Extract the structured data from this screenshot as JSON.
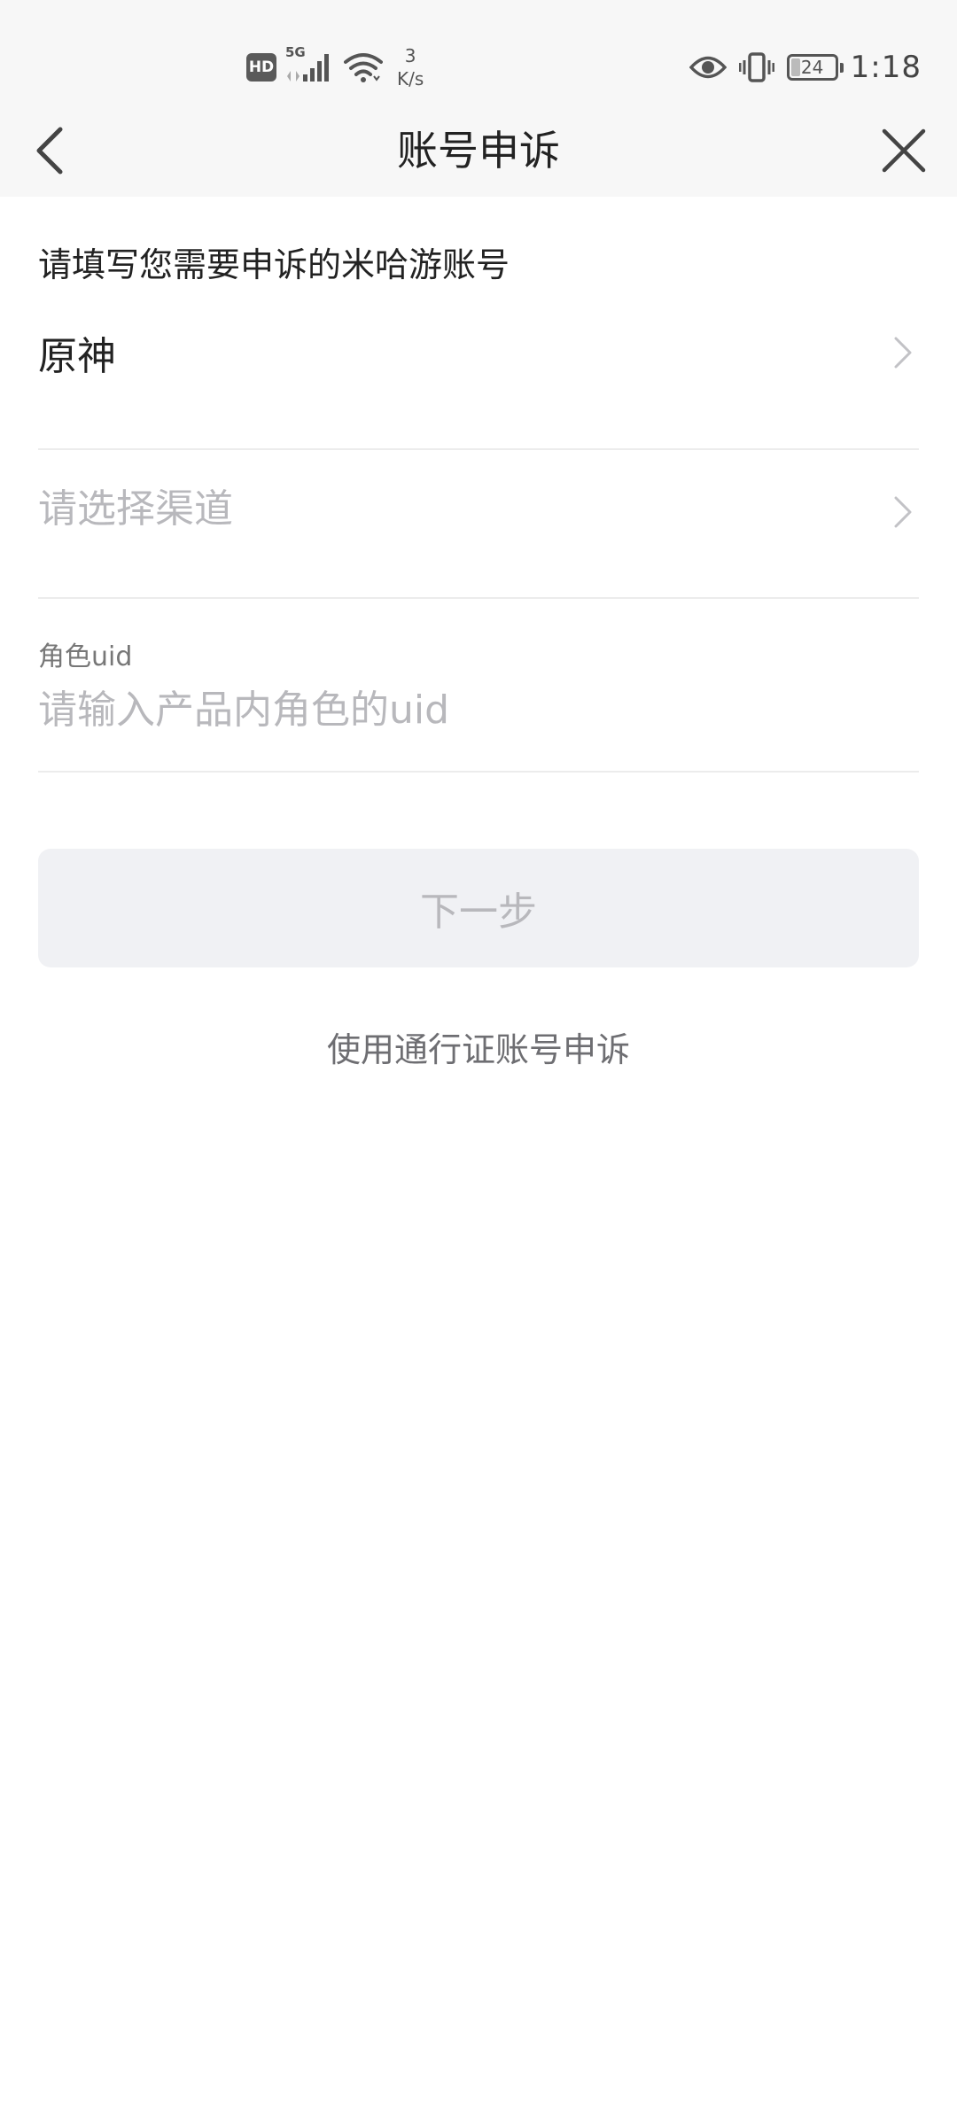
{
  "status_bar": {
    "hd_label": "HD",
    "network_label": "5G",
    "speed_value": "3",
    "speed_unit": "K/s",
    "battery_level": "24",
    "time": "1:18",
    "icons": [
      "hd-icon",
      "signal-icon",
      "wifi-icon",
      "eye-icon",
      "vibrate-icon",
      "battery-icon"
    ]
  },
  "nav": {
    "title": "账号申诉",
    "back_icon": "chevron-left-icon",
    "close_icon": "close-icon"
  },
  "form": {
    "section_title": "请填写您需要申诉的米哈游账号",
    "game_selected": "原神",
    "channel_placeholder": "请选择渠道",
    "uid_label": "角色uid",
    "uid_placeholder": "请输入产品内角色的uid",
    "uid_value": ""
  },
  "actions": {
    "next_label": "下一步",
    "alt_link_label": "使用通行证账号申诉"
  },
  "colors": {
    "header_bg": "#f7f7f7",
    "placeholder": "#b8b8bc",
    "divider": "#ececec",
    "button_bg_disabled": "#f0f1f4",
    "link_text": "#6e6e72"
  }
}
